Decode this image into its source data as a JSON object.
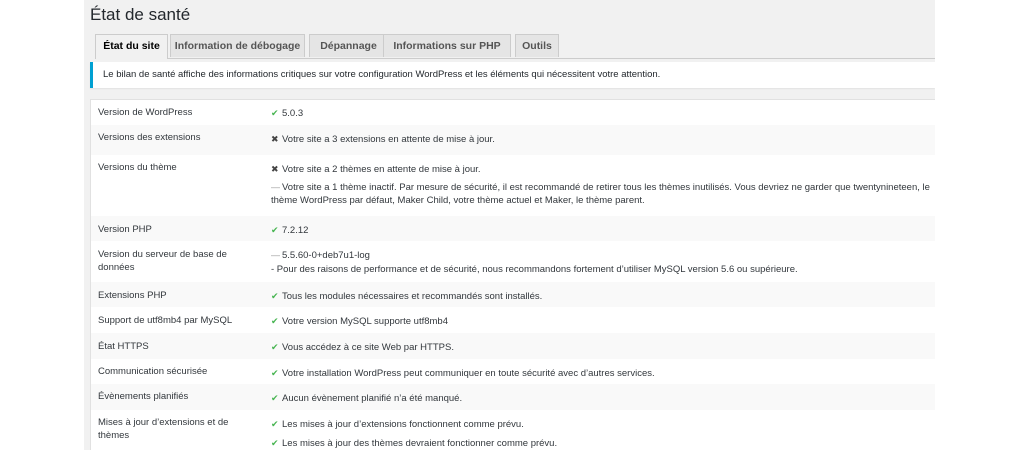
{
  "page_title": "État de santé",
  "tabs": [
    {
      "label": "État du site",
      "active": true
    },
    {
      "label": "Information de débogage",
      "active": false
    },
    {
      "label": "Dépannage",
      "active": false
    },
    {
      "label": "Informations sur PHP",
      "active": false
    },
    {
      "label": "Outils",
      "active": false
    }
  ],
  "notice": "Le bilan de santé affiche des informations critiques sur votre configuration WordPress et les éléments qui nécessitent votre attention.",
  "colors": {
    "good": "#46b450",
    "accent": "#00a0d2"
  },
  "icons": {
    "good": "✔",
    "bad": "✖",
    "neutral": "—"
  },
  "rows": [
    {
      "label": "Version de WordPress",
      "lines": [
        {
          "status": "good",
          "text": "5.0.3"
        }
      ]
    },
    {
      "label": "Versions des extensions",
      "lines": [
        {
          "status": "bad",
          "text": "Votre site a 3 extensions en attente de mise à jour."
        }
      ]
    },
    {
      "label": "Versions du thème",
      "lines": [
        {
          "status": "bad",
          "text": "Votre site a 2 thèmes en attente de mise à jour."
        },
        {
          "status": "neutral",
          "text": "Votre site a 1 thème inactif. Par mesure de sécurité, il est recommandé de retirer tous les thèmes inutilisés. Vous devriez ne garder que twentynineteen, le thème WordPress par défaut, Maker Child, votre thème actuel et Maker, le thème parent."
        }
      ]
    },
    {
      "label": "Version PHP",
      "lines": [
        {
          "status": "good",
          "text": "7.2.12"
        }
      ]
    },
    {
      "label": "Version du serveur de base de données",
      "lines": [
        {
          "status": "neutral",
          "text": "5.5.60-0+deb7u1-log"
        },
        {
          "status": "none",
          "text": "- Pour des raisons de performance et de sécurité, nous recommandons fortement d’utiliser MySQL version 5.6 ou supérieure."
        }
      ]
    },
    {
      "label": "Extensions PHP",
      "lines": [
        {
          "status": "good",
          "text": "Tous les modules nécessaires et recommandés sont installés."
        }
      ]
    },
    {
      "label": "Support de utf8mb4 par MySQL",
      "lines": [
        {
          "status": "good",
          "text": "Votre version MySQL supporte utf8mb4"
        }
      ]
    },
    {
      "label": "État HTTPS",
      "lines": [
        {
          "status": "good",
          "text": "Vous accédez à ce site Web par HTTPS."
        }
      ]
    },
    {
      "label": "Communication sécurisée",
      "lines": [
        {
          "status": "good",
          "text": "Votre installation WordPress peut communiquer en toute sécurité avec d’autres services."
        }
      ]
    },
    {
      "label": "Évènements planifiés",
      "lines": [
        {
          "status": "good",
          "text": "Aucun évènement planifié n’a été manqué."
        }
      ]
    },
    {
      "label": "Mises à jour d’extensions et de thèmes",
      "lines": [
        {
          "status": "good",
          "text": "Les mises à jour d’extensions fonctionnent comme prévu."
        },
        {
          "status": "good",
          "text": "Les mises à jour des thèmes devraient fonctionner comme prévu."
        }
      ]
    }
  ]
}
